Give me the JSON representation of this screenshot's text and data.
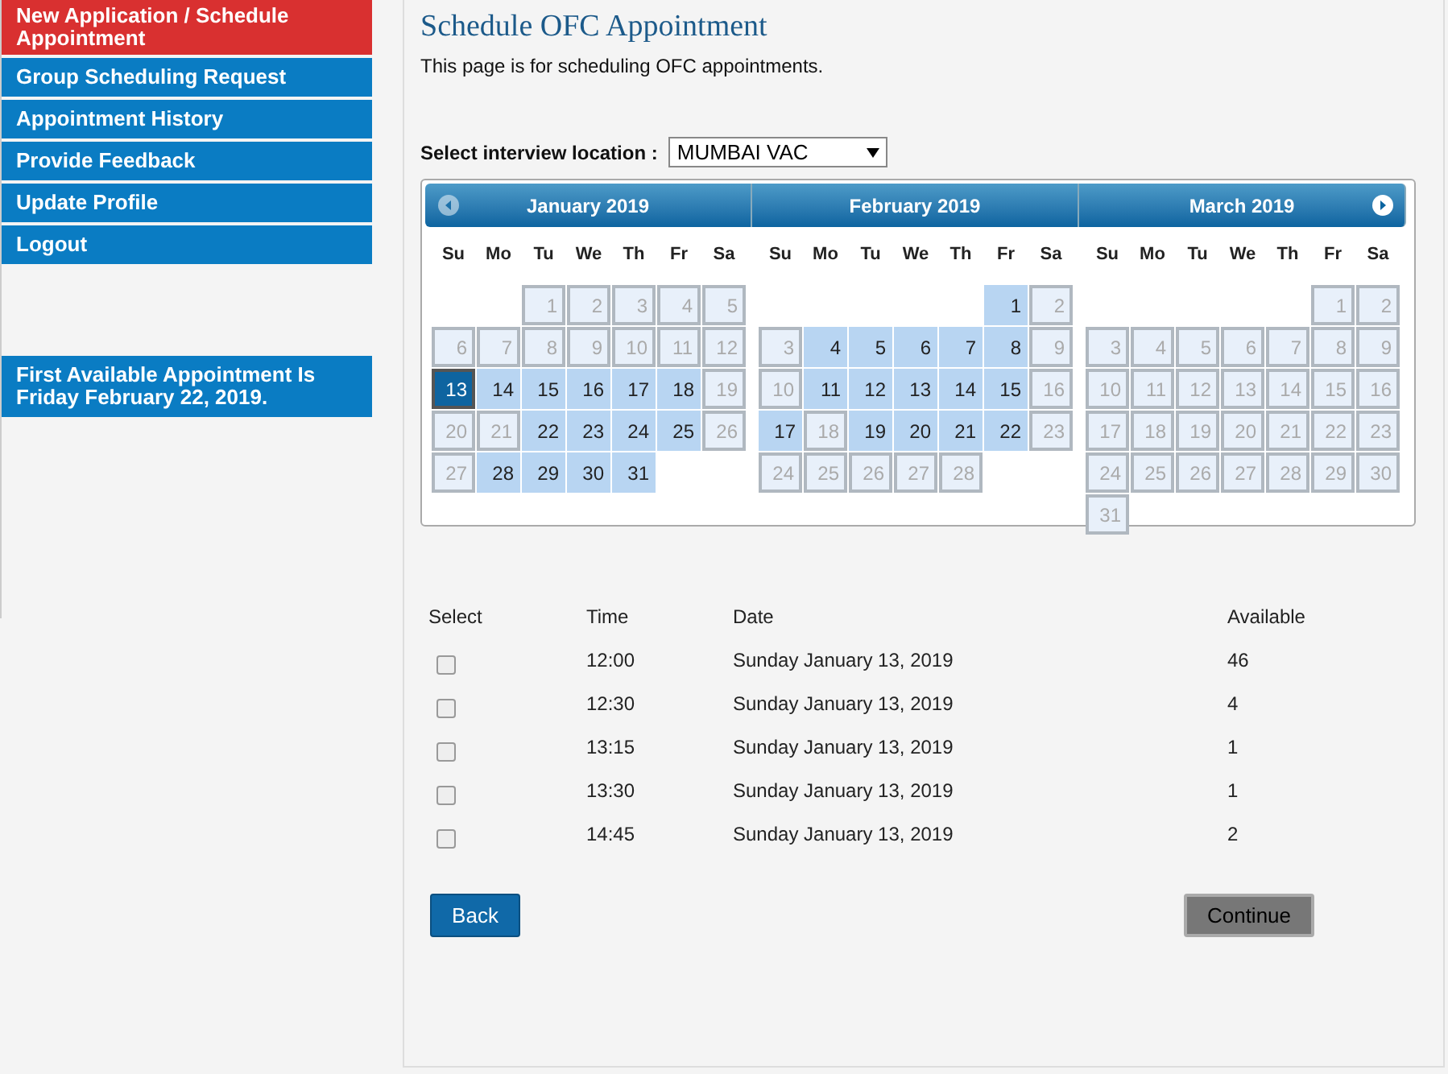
{
  "sidebar": {
    "items": [
      {
        "label": "New Application / Schedule Appointment",
        "selected": true
      },
      {
        "label": "Group Scheduling Request",
        "selected": false
      },
      {
        "label": "Appointment History",
        "selected": false
      },
      {
        "label": "Provide Feedback",
        "selected": false
      },
      {
        "label": "Update Profile",
        "selected": false
      },
      {
        "label": "Logout",
        "selected": false
      }
    ],
    "notice": "First Available Appointment Is Friday February 22, 2019."
  },
  "page": {
    "title": "Schedule OFC Appointment",
    "subtitle": "This page is for scheduling OFC appointments."
  },
  "location": {
    "label": "Select interview location :",
    "value": "MUMBAI VAC"
  },
  "calendar": {
    "months": [
      {
        "title": "January 2019",
        "prev_arrow": true,
        "weekdays": [
          "Su",
          "Mo",
          "Tu",
          "We",
          "Th",
          "Fr",
          "Sa"
        ],
        "weeks": [
          {
            "align_end": true,
            "days": [
              {
                "day": "1",
                "available": false,
                "selected": false
              },
              {
                "day": "2",
                "available": false,
                "selected": false
              },
              {
                "day": "3",
                "available": false,
                "selected": false
              },
              {
                "day": "4",
                "available": false,
                "selected": false
              },
              {
                "day": "5",
                "available": false,
                "selected": false
              }
            ]
          },
          {
            "days": [
              {
                "day": "6",
                "available": false,
                "selected": false
              },
              {
                "day": "7",
                "available": false,
                "selected": false
              },
              {
                "day": "8",
                "available": false,
                "selected": false
              },
              {
                "day": "9",
                "available": false,
                "selected": false
              },
              {
                "day": "10",
                "available": false,
                "selected": false
              },
              {
                "day": "11",
                "available": false,
                "selected": false
              },
              {
                "day": "12",
                "available": false,
                "selected": false
              }
            ]
          },
          {
            "days": [
              {
                "day": "13",
                "available": true,
                "selected": true
              },
              {
                "day": "14",
                "available": true,
                "selected": false
              },
              {
                "day": "15",
                "available": true,
                "selected": false
              },
              {
                "day": "16",
                "available": true,
                "selected": false
              },
              {
                "day": "17",
                "available": true,
                "selected": false
              },
              {
                "day": "18",
                "available": true,
                "selected": false
              },
              {
                "day": "19",
                "available": false,
                "selected": false
              }
            ]
          },
          {
            "days": [
              {
                "day": "20",
                "available": false,
                "selected": false
              },
              {
                "day": "21",
                "available": false,
                "selected": false
              },
              {
                "day": "22",
                "available": true,
                "selected": false
              },
              {
                "day": "23",
                "available": true,
                "selected": false
              },
              {
                "day": "24",
                "available": true,
                "selected": false
              },
              {
                "day": "25",
                "available": true,
                "selected": false
              },
              {
                "day": "26",
                "available": false,
                "selected": false
              }
            ]
          },
          {
            "days": [
              {
                "day": "27",
                "available": false,
                "selected": false
              },
              {
                "day": "28",
                "available": true,
                "selected": false
              },
              {
                "day": "29",
                "available": true,
                "selected": false
              },
              {
                "day": "30",
                "available": true,
                "selected": false
              },
              {
                "day": "31",
                "available": true,
                "selected": false
              }
            ]
          }
        ]
      },
      {
        "title": "February 2019",
        "weekdays": [
          "Su",
          "Mo",
          "Tu",
          "We",
          "Th",
          "Fr",
          "Sa"
        ],
        "weeks": [
          {
            "align_end": true,
            "days": [
              {
                "day": "1",
                "available": true,
                "selected": false
              },
              {
                "day": "2",
                "available": false,
                "selected": false
              }
            ]
          },
          {
            "days": [
              {
                "day": "3",
                "available": false,
                "selected": false
              },
              {
                "day": "4",
                "available": true,
                "selected": false
              },
              {
                "day": "5",
                "available": true,
                "selected": false
              },
              {
                "day": "6",
                "available": true,
                "selected": false
              },
              {
                "day": "7",
                "available": true,
                "selected": false
              },
              {
                "day": "8",
                "available": true,
                "selected": false
              },
              {
                "day": "9",
                "available": false,
                "selected": false
              }
            ]
          },
          {
            "days": [
              {
                "day": "10",
                "available": false,
                "selected": false
              },
              {
                "day": "11",
                "available": true,
                "selected": false
              },
              {
                "day": "12",
                "available": true,
                "selected": false
              },
              {
                "day": "13",
                "available": true,
                "selected": false
              },
              {
                "day": "14",
                "available": true,
                "selected": false
              },
              {
                "day": "15",
                "available": true,
                "selected": false
              },
              {
                "day": "16",
                "available": false,
                "selected": false
              }
            ]
          },
          {
            "days": [
              {
                "day": "17",
                "available": true,
                "selected": false
              },
              {
                "day": "18",
                "available": false,
                "selected": false
              },
              {
                "day": "19",
                "available": true,
                "selected": false
              },
              {
                "day": "20",
                "available": true,
                "selected": false
              },
              {
                "day": "21",
                "available": true,
                "selected": false
              },
              {
                "day": "22",
                "available": true,
                "selected": false
              },
              {
                "day": "23",
                "available": false,
                "selected": false
              }
            ]
          },
          {
            "days": [
              {
                "day": "24",
                "available": false,
                "selected": false
              },
              {
                "day": "25",
                "available": false,
                "selected": false
              },
              {
                "day": "26",
                "available": false,
                "selected": false
              },
              {
                "day": "27",
                "available": false,
                "selected": false
              },
              {
                "day": "28",
                "available": false,
                "selected": false
              }
            ]
          }
        ]
      },
      {
        "title": "March 2019",
        "next_arrow": true,
        "weekdays": [
          "Su",
          "Mo",
          "Tu",
          "We",
          "Th",
          "Fr",
          "Sa"
        ],
        "weeks": [
          {
            "align_end": true,
            "days": [
              {
                "day": "1",
                "available": false,
                "selected": false
              },
              {
                "day": "2",
                "available": false,
                "selected": false
              }
            ]
          },
          {
            "days": [
              {
                "day": "3",
                "available": false,
                "selected": false
              },
              {
                "day": "4",
                "available": false,
                "selected": false
              },
              {
                "day": "5",
                "available": false,
                "selected": false
              },
              {
                "day": "6",
                "available": false,
                "selected": false
              },
              {
                "day": "7",
                "available": false,
                "selected": false
              },
              {
                "day": "8",
                "available": false,
                "selected": false
              },
              {
                "day": "9",
                "available": false,
                "selected": false
              }
            ]
          },
          {
            "days": [
              {
                "day": "10",
                "available": false,
                "selected": false
              },
              {
                "day": "11",
                "available": false,
                "selected": false
              },
              {
                "day": "12",
                "available": false,
                "selected": false
              },
              {
                "day": "13",
                "available": false,
                "selected": false
              },
              {
                "day": "14",
                "available": false,
                "selected": false
              },
              {
                "day": "15",
                "available": false,
                "selected": false
              },
              {
                "day": "16",
                "available": false,
                "selected": false
              }
            ]
          },
          {
            "days": [
              {
                "day": "17",
                "available": false,
                "selected": false
              },
              {
                "day": "18",
                "available": false,
                "selected": false
              },
              {
                "day": "19",
                "available": false,
                "selected": false
              },
              {
                "day": "20",
                "available": false,
                "selected": false
              },
              {
                "day": "21",
                "available": false,
                "selected": false
              },
              {
                "day": "22",
                "available": false,
                "selected": false
              },
              {
                "day": "23",
                "available": false,
                "selected": false
              }
            ]
          },
          {
            "days": [
              {
                "day": "24",
                "available": false,
                "selected": false
              },
              {
                "day": "25",
                "available": false,
                "selected": false
              },
              {
                "day": "26",
                "available": false,
                "selected": false
              },
              {
                "day": "27",
                "available": false,
                "selected": false
              },
              {
                "day": "28",
                "available": false,
                "selected": false
              },
              {
                "day": "29",
                "available": false,
                "selected": false
              },
              {
                "day": "30",
                "available": false,
                "selected": false
              }
            ]
          },
          {
            "days": [
              {
                "day": "31",
                "available": false,
                "selected": false
              }
            ]
          }
        ]
      }
    ]
  },
  "slots": {
    "columns": [
      "Select",
      "Time",
      "Date",
      "Available"
    ],
    "rows": [
      {
        "time": "12:00",
        "date": "Sunday January 13, 2019",
        "available": "46",
        "checked": false
      },
      {
        "time": "12:30",
        "date": "Sunday January 13, 2019",
        "available": "4",
        "checked": false
      },
      {
        "time": "13:15",
        "date": "Sunday January 13, 2019",
        "available": "1",
        "checked": false
      },
      {
        "time": "13:30",
        "date": "Sunday January 13, 2019",
        "available": "1",
        "checked": false
      },
      {
        "time": "14:45",
        "date": "Sunday January 13, 2019",
        "available": "2",
        "checked": false
      }
    ]
  },
  "buttons": [
    {
      "label": "Back",
      "kind": "primary"
    },
    {
      "label": "Continue",
      "kind": "secondary"
    }
  ]
}
